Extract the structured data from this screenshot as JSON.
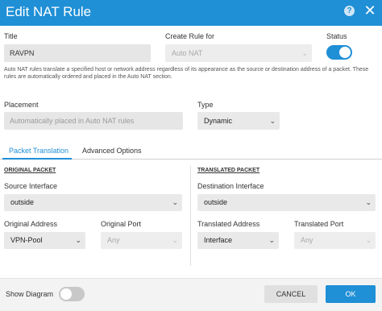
{
  "dialog": {
    "title": "Edit NAT Rule",
    "help_icon": "?",
    "close_icon": "✕"
  },
  "colors": {
    "accent": "#1f8fd6",
    "field_bg": "#e6e6e6",
    "footer_bg": "#f3f3f3"
  },
  "title_field": {
    "label": "Title",
    "value": "RAVPN"
  },
  "create_rule_for": {
    "label": "Create Rule for",
    "value": "Auto NAT"
  },
  "status": {
    "label": "Status",
    "enabled": true
  },
  "note": "Auto NAT rules translate a specified host or network address regardless of its appearance as the source or destination address of a packet. These rules are automatically ordered and placed in the Auto NAT section.",
  "placement": {
    "label": "Placement",
    "value": "Automatically placed in Auto NAT rules"
  },
  "type": {
    "label": "Type",
    "value": "Dynamic"
  },
  "tabs": [
    {
      "label": "Packet Translation",
      "active": true
    },
    {
      "label": "Advanced Options",
      "active": false
    }
  ],
  "original_packet": {
    "title": "ORIGINAL PACKET",
    "source_interface": {
      "label": "Source Interface",
      "value": "outside"
    },
    "original_address": {
      "label": "Original Address",
      "value": "VPN-Pool"
    },
    "original_port": {
      "label": "Original Port",
      "value": "Any"
    }
  },
  "translated_packet": {
    "title": "TRANSLATED PACKET",
    "destination_interface": {
      "label": "Destination Interface",
      "value": "outside"
    },
    "translated_address": {
      "label": "Translated Address",
      "value": "Interface"
    },
    "translated_port": {
      "label": "Translated Port",
      "value": "Any"
    }
  },
  "footer": {
    "show_diagram_label": "Show Diagram",
    "show_diagram_enabled": false,
    "cancel_label": "CANCEL",
    "ok_label": "OK"
  },
  "chevron_glyph": "⌄"
}
